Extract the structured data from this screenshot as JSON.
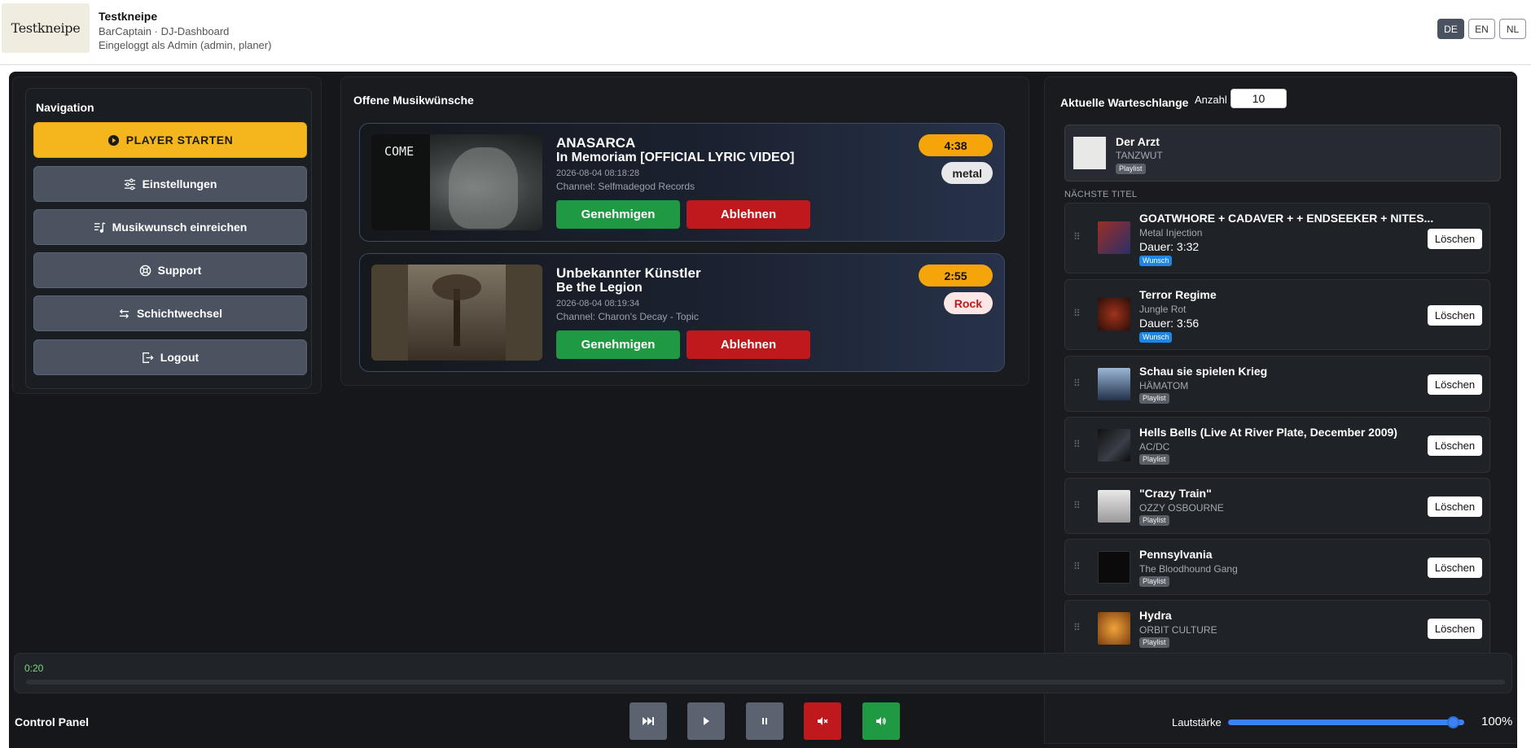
{
  "header": {
    "logo_text": "Testkneipe",
    "venue": "Testkneipe",
    "subtitle": "BarCaptain · DJ-Dashboard",
    "login_info": "Eingeloggt als Admin (admin, planer)",
    "languages": [
      "DE",
      "EN",
      "NL"
    ],
    "active_language": "DE"
  },
  "nav": {
    "title": "Navigation",
    "items": [
      {
        "label": "PLAYER STARTEN",
        "icon": "play-circle-icon"
      },
      {
        "label": "Einstellungen",
        "icon": "sliders-icon"
      },
      {
        "label": "Musikwunsch einreichen",
        "icon": "music-list-icon"
      },
      {
        "label": "Support",
        "icon": "lifebuoy-icon"
      },
      {
        "label": "Schichtwechsel",
        "icon": "swap-arrows-icon"
      },
      {
        "label": "Logout",
        "icon": "logout-icon"
      }
    ]
  },
  "requests": {
    "title": "Offene Musikwünsche",
    "approve_label": "Genehmigen",
    "reject_label": "Ablehnen",
    "items": [
      {
        "artist": "ANASARCA",
        "title": "In Memoriam [OFFICIAL LYRIC VIDEO]",
        "date": "2026-08-04 08:18:28",
        "channel": "Channel: Selfmadegod Records",
        "duration": "4:38",
        "genre": "metal",
        "thumb_text": "COME"
      },
      {
        "artist": "Unbekannter Künstler",
        "title": "Be the Legion",
        "date": "2026-08-04 08:19:34",
        "channel": "Channel: Charon's Decay - Topic",
        "duration": "2:55",
        "genre": "Rock"
      }
    ]
  },
  "queue": {
    "title": "Aktuelle Warteschlange",
    "count_label": "Anzahl",
    "count_value": "10",
    "now_playing": {
      "title": "Der Arzt",
      "artist": "TANZWUT",
      "badge": "Playlist"
    },
    "next_label": "NÄCHSTE TITEL",
    "delete_label": "Löschen",
    "items": [
      {
        "title": "GOATWHORE + CADAVER + + ENDSEEKER + NITES...",
        "artist": "Metal Injection",
        "duration": "Dauer: 3:32",
        "badge": "Wunsch"
      },
      {
        "title": "Terror Regime",
        "artist": "Jungle Rot",
        "duration": "Dauer: 3:56",
        "badge": "Wunsch"
      },
      {
        "title": "Schau sie spielen Krieg",
        "artist": "HÄMATOM",
        "badge": "Playlist"
      },
      {
        "title": "Hells Bells (Live At River Plate, December 2009)",
        "artist": "AC/DC",
        "badge": "Playlist"
      },
      {
        "title": "\"Crazy Train\"",
        "artist": "OZZY OSBOURNE",
        "badge": "Playlist"
      },
      {
        "title": "Pennsylvania",
        "artist": "The Bloodhound Gang",
        "badge": "Playlist"
      },
      {
        "title": "Hydra",
        "artist": "ORBIT CULTURE",
        "badge": "Playlist"
      }
    ]
  },
  "player": {
    "time": "0:20",
    "progress": 0.0,
    "control_label": "Control Panel",
    "volume_label": "Lautstärke",
    "volume": 0.95,
    "volume_pct": "100%",
    "colors": {
      "skip": "#5b6270",
      "play": "#5b6270",
      "pause": "#5b6270",
      "mute": "#c0191d",
      "unmute": "#1f9a43"
    }
  }
}
